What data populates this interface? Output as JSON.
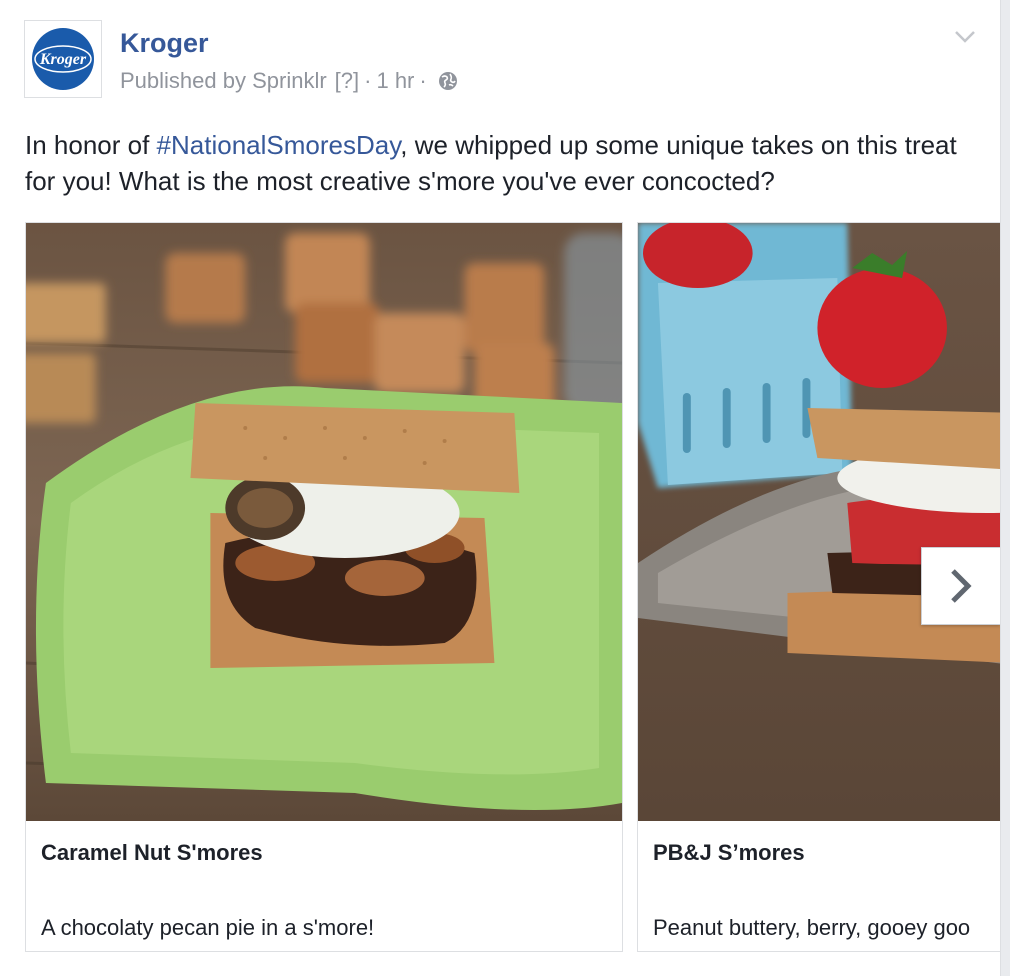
{
  "post": {
    "page_name": "Kroger",
    "logo_text": "Kroger",
    "published_by": "Published by Sprinklr",
    "help_marker": "[?]",
    "separator": "·",
    "time": "1 hr",
    "privacy_icon": "globe-icon",
    "menu_icon": "chevron-down-icon",
    "text_before": "In honor of ",
    "hashtag": "#NationalSmoresDay",
    "text_after": ", we whipped up some unique takes on this treat for you! What is the most creative s'more you've ever concocted?"
  },
  "carousel": {
    "cards": [
      {
        "title": "Caramel Nut S'mores",
        "description": "A chocolaty pecan pie in a s'more!"
      },
      {
        "title": "PB&J S’mores",
        "description": "Peanut buttery, berry, gooey goo"
      }
    ],
    "next_icon": "chevron-right-icon"
  },
  "colors": {
    "link": "#365899",
    "meta": "#90949c",
    "text": "#1d2129",
    "kroger_blue": "#1a5bab",
    "plate_green": "#9acc6e"
  }
}
